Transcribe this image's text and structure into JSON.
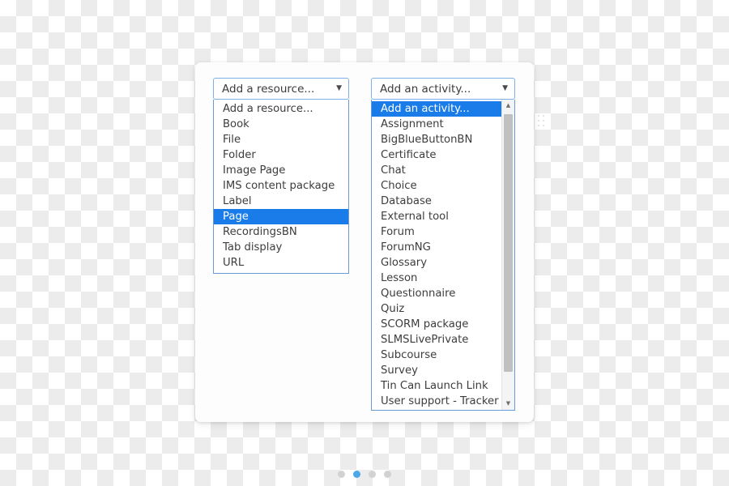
{
  "background": {
    "type": "transparency-checkerboard",
    "light": "#ffffff",
    "dark": "#ececec",
    "square_size_px": 20
  },
  "colors": {
    "highlight": "#1a7ce8",
    "select_border": "#7eb0e8",
    "list_border": "#6b9bd6",
    "text": "#3d3d3d",
    "pager_active": "#4aa8e8",
    "pager_inactive": "#d2d2d2",
    "scrollbar_thumb": "#c0c0c0"
  },
  "resource_dropdown": {
    "name": "Add a resource",
    "selected_value": "Add a resource...",
    "caret_icon": "▼",
    "highlighted_option": "Page",
    "options": [
      "Add a resource...",
      "Book",
      "File",
      "Folder",
      "Image Page",
      "IMS content package",
      "Label",
      "Page",
      "RecordingsBN",
      "Tab display",
      "URL"
    ]
  },
  "activity_dropdown": {
    "name": "Add an activity",
    "selected_value": "Add an activity...",
    "caret_icon": "▼",
    "highlighted_option": "Add an activity...",
    "scrollbar": {
      "up_arrow_icon": "▲",
      "down_arrow_icon": "▼"
    },
    "options": [
      "Add an activity...",
      "Assignment",
      "BigBlueButtonBN",
      "Certificate",
      "Chat",
      "Choice",
      "Database",
      "External tool",
      "Forum",
      "ForumNG",
      "Glossary",
      "Lesson",
      "Questionnaire",
      "Quiz",
      "SCORM package",
      "SLMSLivePrivate",
      "Subcourse",
      "Survey",
      "Tin Can Launch Link",
      "User support - Tracker"
    ]
  },
  "pager": {
    "total": 4,
    "active_index": 1
  }
}
